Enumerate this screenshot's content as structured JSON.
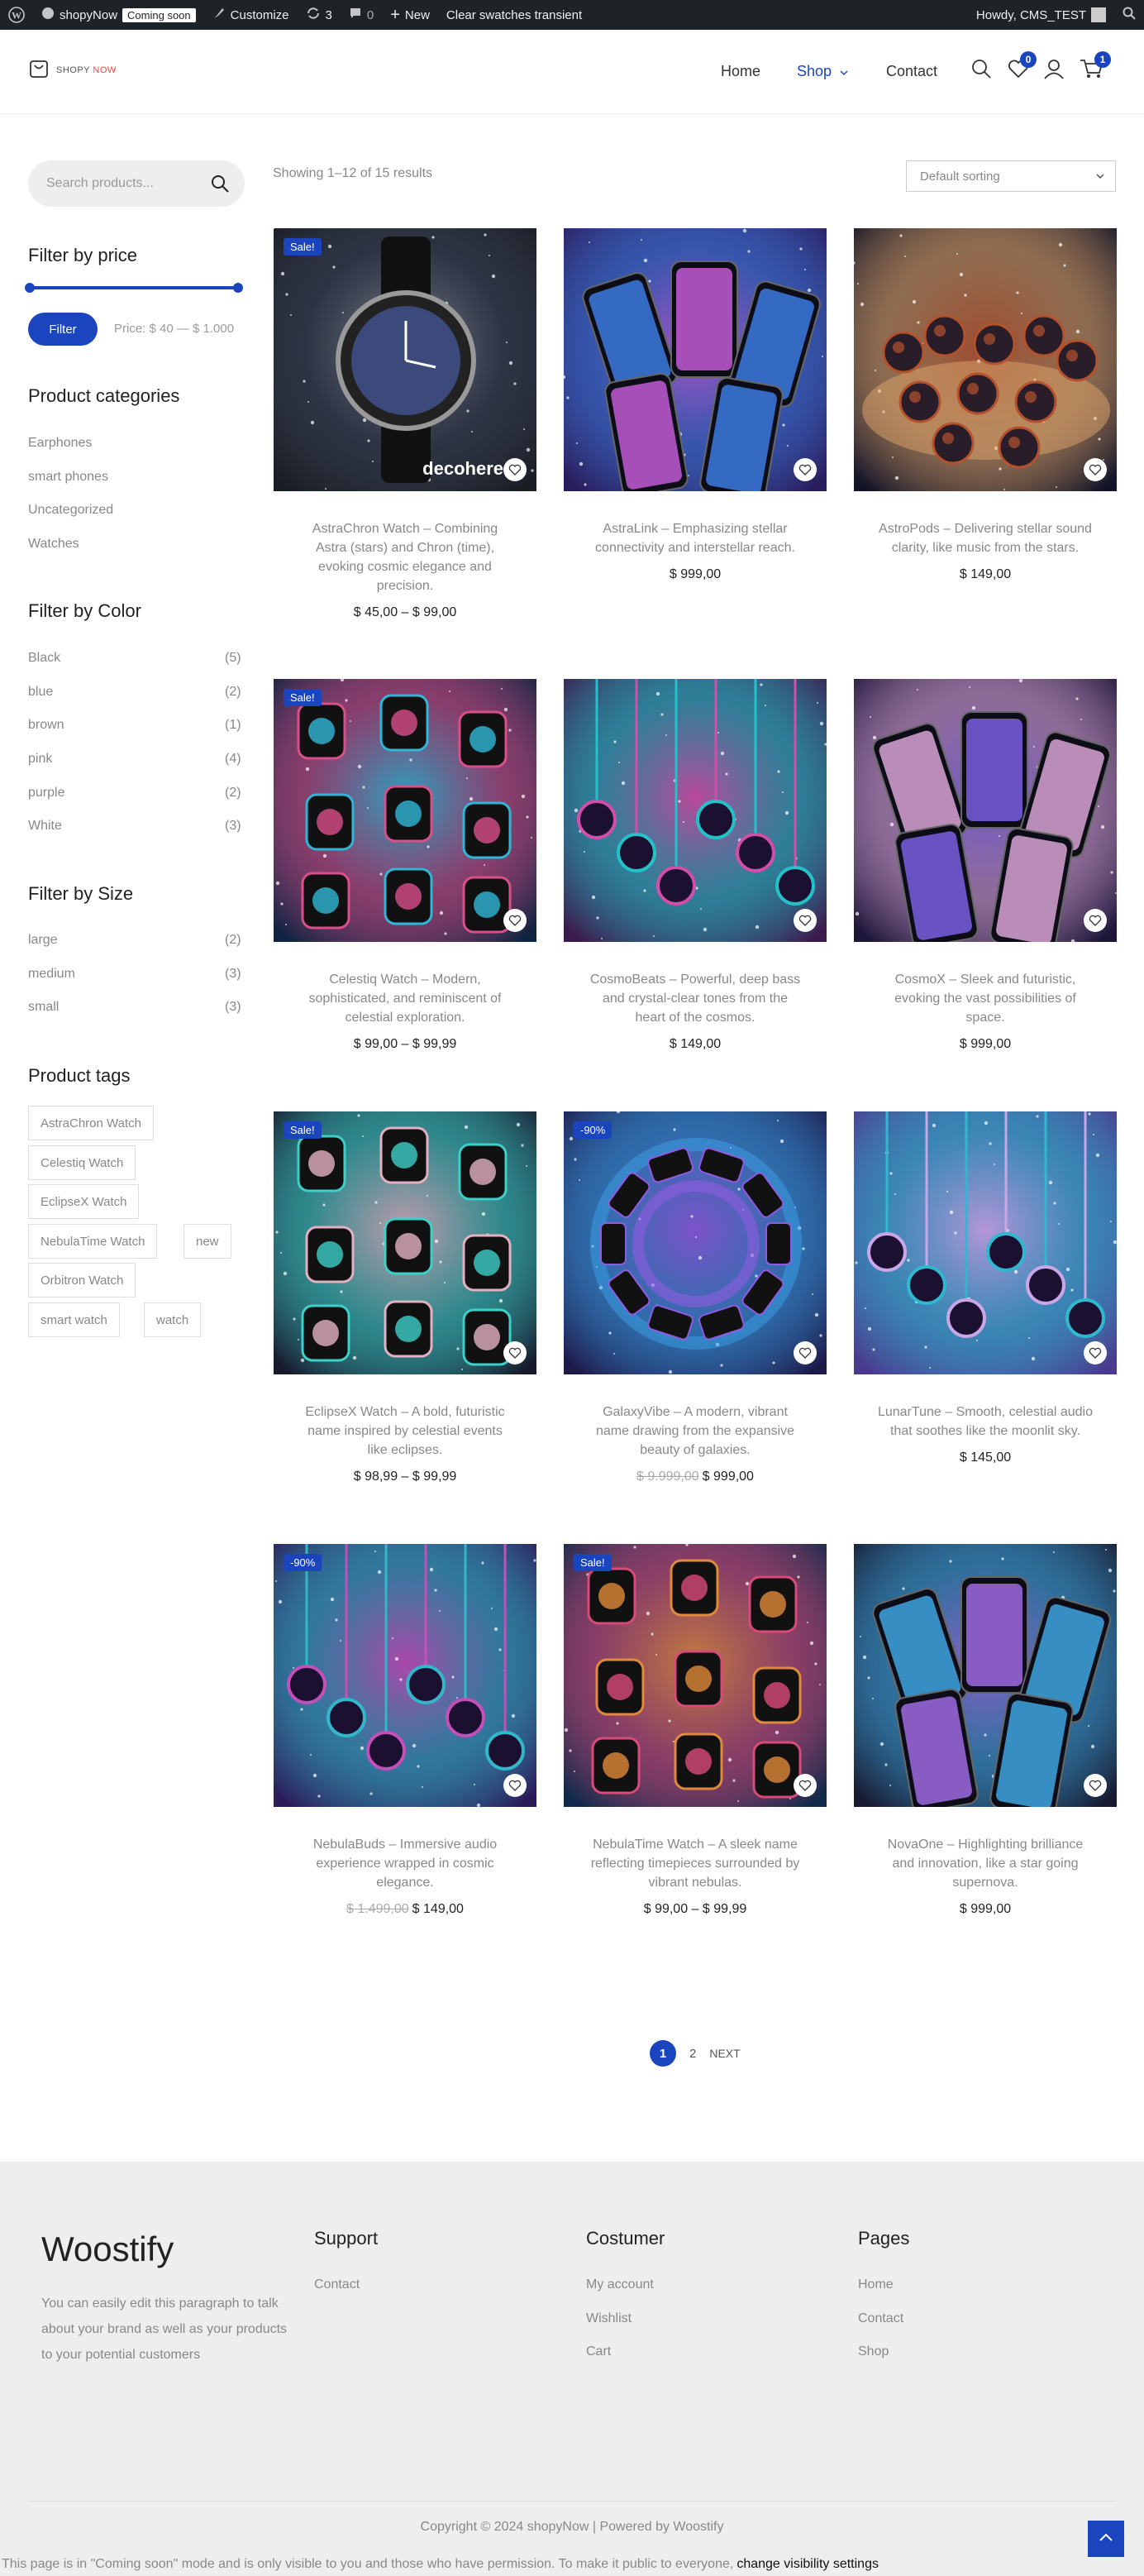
{
  "admin_bar": {
    "site_name": "shopyNow",
    "coming_soon": "Coming soon",
    "customize": "Customize",
    "updates_count": "3",
    "comments_count": "0",
    "new": "New",
    "clear_swatches": "Clear swatches transient",
    "howdy": "Howdy, CMS_TEST"
  },
  "header": {
    "logo_text_1": "SHOPY",
    "logo_text_2": "NOW",
    "nav": {
      "home": "Home",
      "shop": "Shop",
      "contact": "Contact"
    },
    "wishlist_count": "0",
    "cart_count": "1"
  },
  "sidebar": {
    "search_placeholder": "Search products...",
    "filter_price_title": "Filter by price",
    "filter_button": "Filter",
    "price_range": "Price: $ 40 — $ 1.000",
    "categories_title": "Product categories",
    "categories": [
      "Earphones",
      "smart phones",
      "Uncategorized",
      "Watches"
    ],
    "color_title": "Filter by Color",
    "colors": [
      {
        "name": "Black",
        "count": "(5)"
      },
      {
        "name": "blue",
        "count": "(2)"
      },
      {
        "name": "brown",
        "count": "(1)"
      },
      {
        "name": "pink",
        "count": "(4)"
      },
      {
        "name": "purple",
        "count": "(2)"
      },
      {
        "name": "White",
        "count": "(3)"
      }
    ],
    "size_title": "Filter by Size",
    "sizes": [
      {
        "name": "large",
        "count": "(2)"
      },
      {
        "name": "medium",
        "count": "(3)"
      },
      {
        "name": "small",
        "count": "(3)"
      }
    ],
    "tags_title": "Product tags",
    "tags": [
      "AstraChron Watch",
      "Celestiq Watch",
      "EclipseX Watch",
      "NebulaTime Watch",
      "new",
      "Orbitron Watch",
      "smart watch",
      "watch"
    ]
  },
  "shop": {
    "result_count": "Showing 1–12 of 15 results",
    "sorting": "Default sorting",
    "products": [
      {
        "title": "AstraChron Watch – Combining Astra (stars) and Chron (time), evoking cosmic elegance and precision.",
        "price": "$ 45,00 – $ 99,00",
        "old_price": "",
        "badge": "Sale!",
        "image_text": "decohere",
        "kind": "watch",
        "palette": [
          "#1a1d24",
          "#8c92a0",
          "#3a4256"
        ]
      },
      {
        "title": "AstraLink – Emphasizing stellar connectivity and interstellar reach.",
        "price": "$ 999,00",
        "old_price": "",
        "badge": "",
        "image_text": "",
        "kind": "phones",
        "palette": [
          "#2a1d5c",
          "#c25cd6",
          "#3d7be0"
        ]
      },
      {
        "title": "AstroPods – Delivering stellar sound clarity, like music from the stars.",
        "price": "$ 149,00",
        "old_price": "",
        "badge": "",
        "image_text": "",
        "kind": "pods",
        "palette": [
          "#121428",
          "#b4522e",
          "#e0a66b"
        ]
      },
      {
        "title": "Celestiq Watch – Modern, sophisticated, and reminiscent of celestial exploration.",
        "price": "$ 99,00 – $ 99,99",
        "old_price": "",
        "badge": "Sale!",
        "image_text": "",
        "kind": "watch-grid",
        "palette": [
          "#0f2440",
          "#2fb6d6",
          "#d94f8a"
        ]
      },
      {
        "title": "CosmoBeats – Powerful, deep bass and crystal-clear tones from the heart of the cosmos.",
        "price": "$ 149,00",
        "old_price": "",
        "badge": "",
        "image_text": "",
        "kind": "earbuds",
        "palette": [
          "#3b1a4d",
          "#d04fa8",
          "#25c1c8"
        ]
      },
      {
        "title": "CosmoX – Sleek and futuristic, evoking the vast possibilities of space.",
        "price": "$ 999,00",
        "old_price": "",
        "badge": "",
        "image_text": "",
        "kind": "phones",
        "palette": [
          "#1c1538",
          "#7a5fe0",
          "#d9a5d6"
        ]
      },
      {
        "title": "EclipseX Watch – A bold, futuristic name inspired by celestial events like eclipses.",
        "price": "$ 98,99 – $ 99,99",
        "old_price": "",
        "badge": "Sale!",
        "image_text": "",
        "kind": "watch-grid",
        "palette": [
          "#171a2e",
          "#e3b0c2",
          "#3dd0c8"
        ]
      },
      {
        "title": "GalaxyVibe – A modern, vibrant name drawing from the expansive beauty of galaxies.",
        "price": "$ 999,00",
        "old_price": "$ 9.999,00",
        "badge": "-90%",
        "image_text": "",
        "kind": "swirl",
        "palette": [
          "#1d1a4a",
          "#8f5be0",
          "#3aa1e8"
        ]
      },
      {
        "title": "LunarTune – Smooth, celestial audio that soothes like the moonlit sky.",
        "price": "$ 145,00",
        "old_price": "",
        "badge": "",
        "image_text": "",
        "kind": "earbuds",
        "palette": [
          "#4a3a8c",
          "#c9a6e6",
          "#2fb8d0"
        ]
      },
      {
        "title": "NebulaBuds – Immersive audio experience wrapped in cosmic elegance.",
        "price": "$ 149,00",
        "old_price": "$ 1.499,00",
        "badge": "-90%",
        "image_text": "",
        "kind": "earbuds",
        "palette": [
          "#2b1b58",
          "#c34fb8",
          "#33b6c9"
        ]
      },
      {
        "title": "NebulaTime Watch – A sleek name reflecting timepieces surrounded by vibrant nebulas.",
        "price": "$ 99,00 – $ 99,99",
        "old_price": "",
        "badge": "Sale!",
        "image_text": "",
        "kind": "watch-grid",
        "palette": [
          "#0f2a4a",
          "#e08a3a",
          "#d84a7a"
        ]
      },
      {
        "title": "NovaOne – Highlighting brilliance and innovation, like a star going supernova.",
        "price": "$ 999,00",
        "old_price": "",
        "badge": "",
        "image_text": "",
        "kind": "phones",
        "palette": [
          "#171a30",
          "#9f6be0",
          "#3ea6e0"
        ]
      }
    ],
    "pagination": {
      "current": "1",
      "next_page": "2",
      "next": "NEXT"
    }
  },
  "footer": {
    "brand": "Woostify",
    "description": "You can easily edit this paragraph to talk about your brand as well as your products to your potential customers",
    "support_title": "Support",
    "support_links": [
      "Contact"
    ],
    "customer_title": "Costumer",
    "customer_links": [
      "My account",
      "Wishlist",
      "Cart"
    ],
    "pages_title": "Pages",
    "pages_links": [
      "Home",
      "Contact",
      "Shop"
    ],
    "copyright": "Copyright © 2024 shopyNow | Powered by Woostify",
    "notice": "This page is in \"Coming soon\" mode and is only visible to you and those who have permission. To make it public to everyone,",
    "notice_link": "change visibility settings"
  },
  "colors": {
    "accent": "#1b45bf",
    "admin_bar": "#1d2327",
    "footer_bg": "#eeeeee"
  }
}
